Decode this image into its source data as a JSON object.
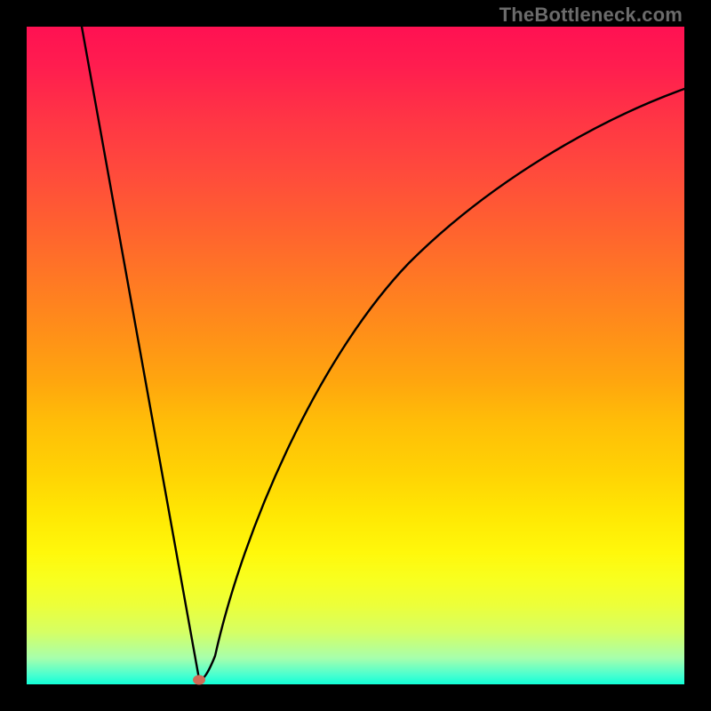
{
  "attribution": "TheBottleneck.com",
  "colors": {
    "background": "#000000",
    "curve_stroke": "#000000",
    "marker_fill": "#d06a57",
    "gradient_stops": [
      "#ff1152",
      "#ff1d4f",
      "#ff3545",
      "#ff4a3c",
      "#ff6030",
      "#ff7725",
      "#ff8e19",
      "#ffa60e",
      "#ffbd08",
      "#ffd304",
      "#ffe703",
      "#fff80b",
      "#f8ff1f",
      "#ecff3a",
      "#d6ff63",
      "#a7ffac",
      "#4cffcf",
      "#12ffd7"
    ]
  },
  "chart_data": {
    "type": "line",
    "title": "",
    "xlabel": "",
    "ylabel": "",
    "xlim": [
      0,
      100
    ],
    "ylim": [
      0,
      100
    ],
    "series": [
      {
        "name": "curve-left",
        "x": [
          8.5,
          12,
          16,
          20,
          24,
          26.3
        ],
        "values": [
          100,
          80,
          58,
          36,
          14,
          1
        ]
      },
      {
        "name": "curve-right",
        "x": [
          26.3,
          28,
          30,
          33,
          37,
          42,
          48,
          55,
          63,
          72,
          82,
          92,
          100
        ],
        "values": [
          1,
          10,
          19,
          30,
          42,
          54,
          64,
          72,
          78,
          83,
          87,
          89.5,
          91
        ]
      }
    ],
    "marker": {
      "x": 26.3,
      "y": 1
    }
  }
}
